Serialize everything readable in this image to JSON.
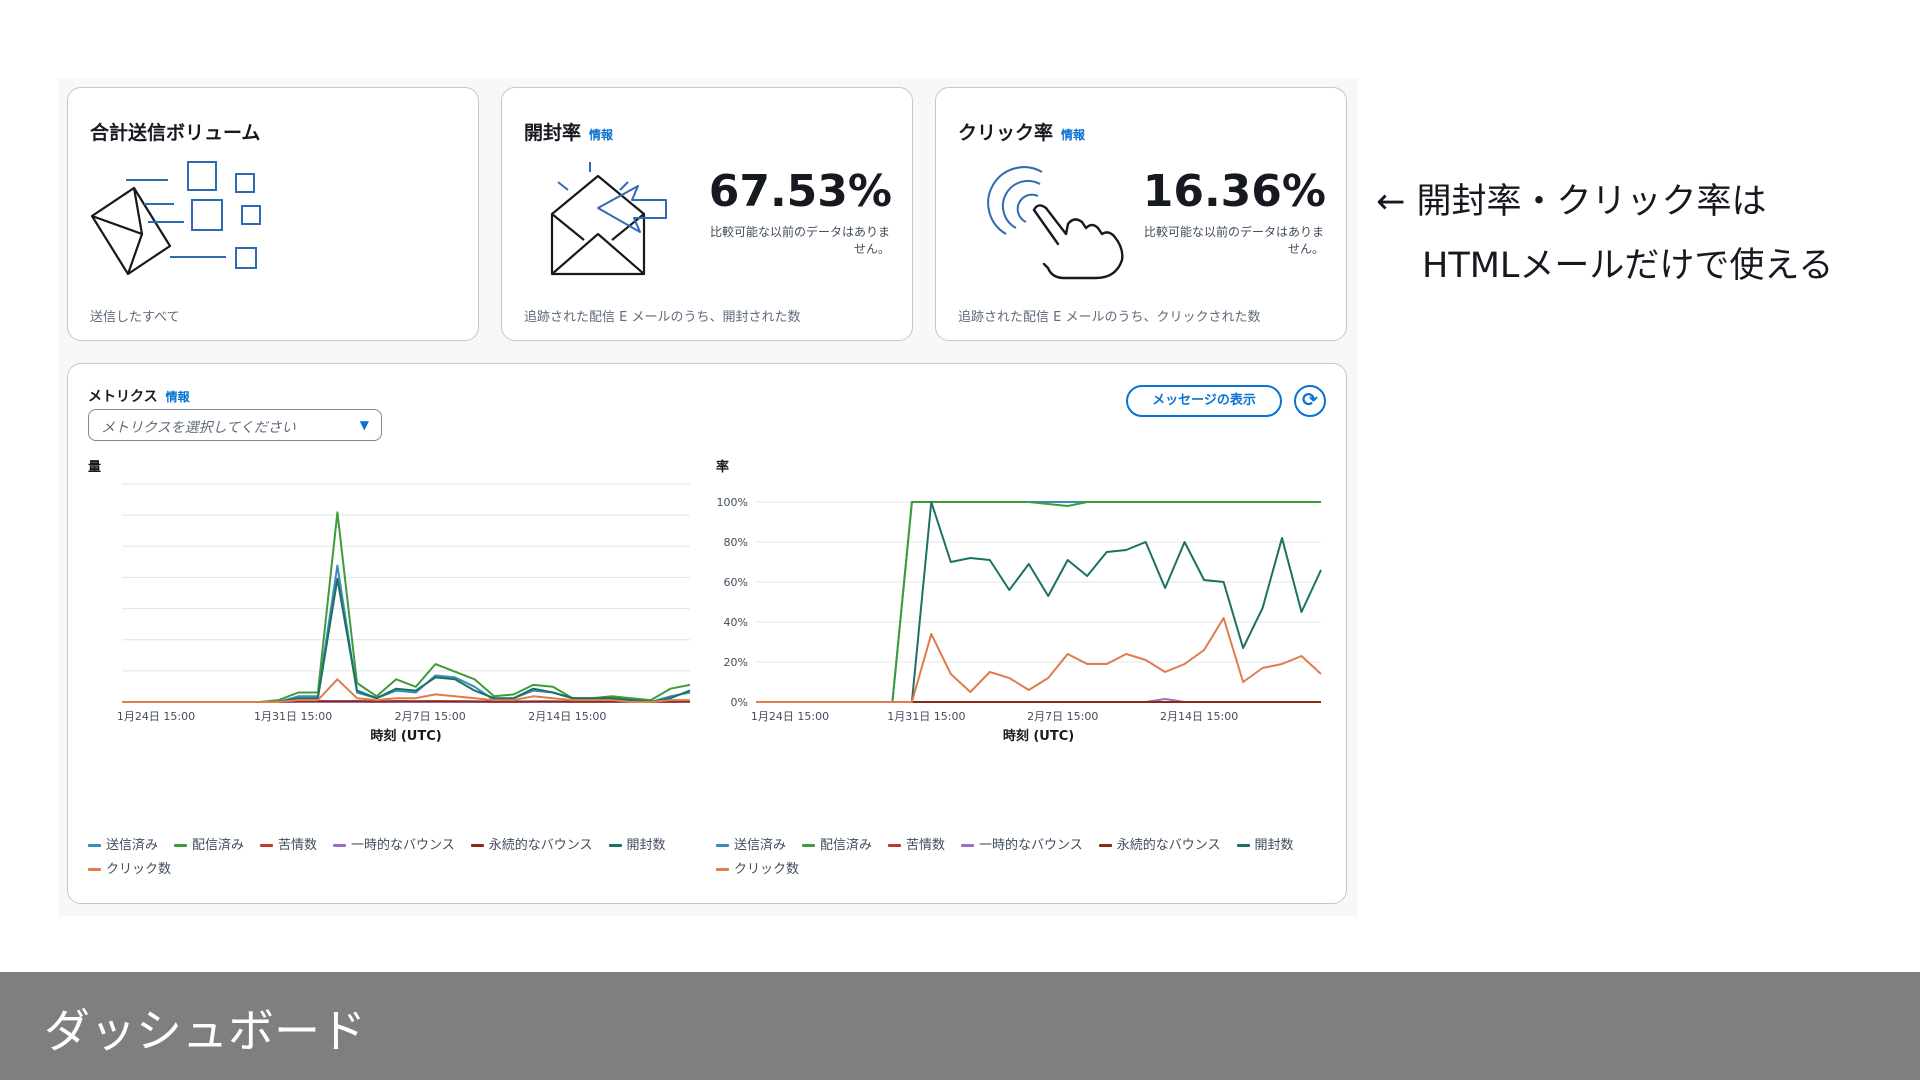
{
  "cards": {
    "volume": {
      "title": "合計送信ボリューム",
      "description": "送信したすべて"
    },
    "open_rate": {
      "title": "開封率",
      "info": "情報",
      "value": "67.53%",
      "note": "比較可能な以前のデータはありません。",
      "description": "追跡された配信 E メールのうち、開封された数"
    },
    "click_rate": {
      "title": "クリック率",
      "info": "情報",
      "value": "16.36%",
      "note": "比較可能な以前のデータはありません。",
      "description": "追跡された配信 E メールのうち、クリックされた数"
    }
  },
  "metrics": {
    "title": "メトリクス",
    "info": "情報",
    "select_placeholder": "メトリクスを選択してください",
    "show_messages_button": "メッセージの表示",
    "refresh_icon": "refresh-icon"
  },
  "legend": [
    {
      "name": "送信済み",
      "color": "#3a8dba"
    },
    {
      "name": "配信済み",
      "color": "#3d9c3a"
    },
    {
      "name": "苦情数",
      "color": "#c0392b"
    },
    {
      "name": "一時的なバウンス",
      "color": "#9b6fc9"
    },
    {
      "name": "永続的なバウンス",
      "color": "#8a2a12"
    },
    {
      "name": "開封数",
      "color": "#1c7064"
    },
    {
      "name": "クリック数",
      "color": "#e07b4c"
    }
  ],
  "chart_data": [
    {
      "type": "line",
      "title": "量",
      "xlabel": "時刻 (UTC)",
      "x_ticks": [
        "1月24日 15:00",
        "1月31日 15:00",
        "2月7日 15:00",
        "2月14日 15:00"
      ],
      "x_tick_positions": [
        0,
        7,
        14,
        21
      ],
      "grid": true,
      "x": [
        0,
        1,
        2,
        3,
        4,
        5,
        6,
        7,
        8,
        9,
        10,
        11,
        12,
        13,
        14,
        15,
        16,
        17,
        18,
        19,
        20,
        21,
        22,
        23,
        24,
        25,
        26,
        27,
        28,
        29
      ],
      "ylim": [
        0,
        115
      ],
      "series": [
        {
          "name": "送信済み",
          "values": [
            0,
            0,
            0,
            0,
            0,
            0,
            0,
            0,
            0,
            3,
            3,
            72,
            5,
            2,
            6,
            5,
            14,
            13,
            8,
            1,
            2,
            6,
            5,
            2,
            2,
            2,
            1,
            0,
            3,
            5
          ]
        },
        {
          "name": "配信済み",
          "values": [
            0,
            0,
            0,
            0,
            0,
            0,
            0,
            0,
            1,
            5,
            5,
            100,
            10,
            3,
            12,
            8,
            20,
            16,
            12,
            3,
            4,
            9,
            8,
            2,
            2,
            3,
            2,
            1,
            7,
            9
          ]
        },
        {
          "name": "苦情数",
          "values": [
            0,
            0,
            0,
            0,
            0,
            0,
            0,
            0,
            0,
            0,
            0,
            0,
            0,
            0,
            0,
            0,
            0,
            0,
            0,
            0,
            0,
            0,
            0,
            0,
            0,
            0,
            0,
            0,
            0,
            0
          ]
        },
        {
          "name": "一時的なバウンス",
          "values": [
            0,
            0,
            0,
            0,
            0,
            0,
            0,
            0,
            0,
            0,
            0,
            0,
            0,
            0,
            0,
            0,
            0,
            0,
            0,
            0,
            0,
            0,
            0,
            0,
            0,
            0,
            0,
            0,
            0,
            0
          ]
        },
        {
          "name": "永続的なバウンス",
          "values": [
            0,
            0,
            0,
            0,
            0,
            0,
            0,
            0,
            0,
            0.5,
            0.5,
            0.5,
            0.5,
            0.3,
            0.5,
            0.4,
            0.5,
            0.4,
            0.3,
            0.2,
            0.2,
            0.3,
            0.3,
            0.2,
            0.2,
            0.2,
            0.2,
            0.1,
            0.2,
            0.3
          ]
        },
        {
          "name": "開封数",
          "values": [
            0,
            0,
            0,
            0,
            0,
            0,
            0,
            0,
            0,
            2,
            2,
            65,
            6,
            2,
            7,
            6,
            13,
            12,
            6,
            2,
            2,
            7,
            5,
            2,
            2,
            2,
            1,
            0,
            2,
            6
          ]
        },
        {
          "name": "クリック数",
          "values": [
            0,
            0,
            0,
            0,
            0,
            0,
            0,
            0,
            0,
            1,
            1,
            12,
            2,
            1,
            2,
            2,
            4,
            3,
            2,
            1,
            1,
            3,
            2,
            1,
            1,
            1,
            0,
            0,
            1,
            1
          ]
        }
      ]
    },
    {
      "type": "line",
      "title": "率",
      "xlabel": "時刻 (UTC)",
      "y_ticks": [
        "0%",
        "20%",
        "40%",
        "60%",
        "80%",
        "100%"
      ],
      "ylim": [
        0,
        100
      ],
      "x_ticks": [
        "1月24日 15:00",
        "1月31日 15:00",
        "2月7日 15:00",
        "2月14日 15:00"
      ],
      "x_tick_positions": [
        0,
        7,
        14,
        21
      ],
      "grid": true,
      "x": [
        0,
        1,
        2,
        3,
        4,
        5,
        6,
        7,
        8,
        9,
        10,
        11,
        12,
        13,
        14,
        15,
        16,
        17,
        18,
        19,
        20,
        21,
        22,
        23,
        24,
        25,
        26,
        27,
        28,
        29
      ],
      "series": [
        {
          "name": "送信済み",
          "values": [
            0,
            0,
            0,
            0,
            0,
            0,
            0,
            0,
            100,
            100,
            100,
            100,
            100,
            100,
            100,
            100,
            100,
            100,
            100,
            100,
            100,
            100,
            100,
            100,
            100,
            100,
            100,
            100,
            100,
            100
          ]
        },
        {
          "name": "配信済み",
          "values": [
            0,
            0,
            0,
            0,
            0,
            0,
            0,
            0,
            100,
            100,
            100,
            100,
            100,
            100,
            100,
            99,
            98,
            100,
            100,
            100,
            100,
            100,
            100,
            100,
            100,
            100,
            100,
            100,
            100,
            100
          ]
        },
        {
          "name": "苦情数",
          "values": [
            0,
            0,
            0,
            0,
            0,
            0,
            0,
            0,
            0,
            0,
            0,
            0,
            0,
            0,
            0,
            0,
            0,
            0,
            0,
            0,
            0,
            0,
            0,
            0,
            0,
            0,
            0,
            0,
            0,
            0
          ]
        },
        {
          "name": "一時的なバウンス",
          "values": [
            0,
            0,
            0,
            0,
            0,
            0,
            0,
            0,
            0,
            0,
            0,
            0,
            0,
            0,
            0,
            0,
            0,
            0,
            0,
            0,
            0,
            1.5,
            0,
            0,
            0,
            0,
            0,
            0,
            0,
            0
          ]
        },
        {
          "name": "永続的なバウンス",
          "values": [
            0,
            0,
            0,
            0,
            0,
            0,
            0,
            0,
            0,
            0,
            0,
            0,
            0,
            0,
            0,
            0,
            0,
            0,
            0,
            0,
            0,
            0,
            0,
            0,
            0,
            0,
            0,
            0,
            0,
            0
          ]
        },
        {
          "name": "開封数",
          "values": [
            0,
            0,
            0,
            0,
            0,
            0,
            0,
            0,
            0,
            100,
            70,
            72,
            71,
            56,
            69,
            53,
            71,
            63,
            75,
            76,
            80,
            57,
            80,
            61,
            60,
            27,
            47,
            82,
            45,
            66
          ]
        },
        {
          "name": "クリック数",
          "values": [
            0,
            0,
            0,
            0,
            0,
            0,
            0,
            0,
            0,
            34,
            14,
            5,
            15,
            12,
            6,
            12,
            24,
            19,
            19,
            24,
            21,
            15,
            19,
            26,
            42,
            10,
            17,
            19,
            23,
            14
          ]
        }
      ]
    }
  ],
  "annotation": {
    "line1": "← 開封率・クリック率は",
    "line2": "HTMLメールだけで使える"
  },
  "footer": {
    "title": "ダッシュボード"
  }
}
